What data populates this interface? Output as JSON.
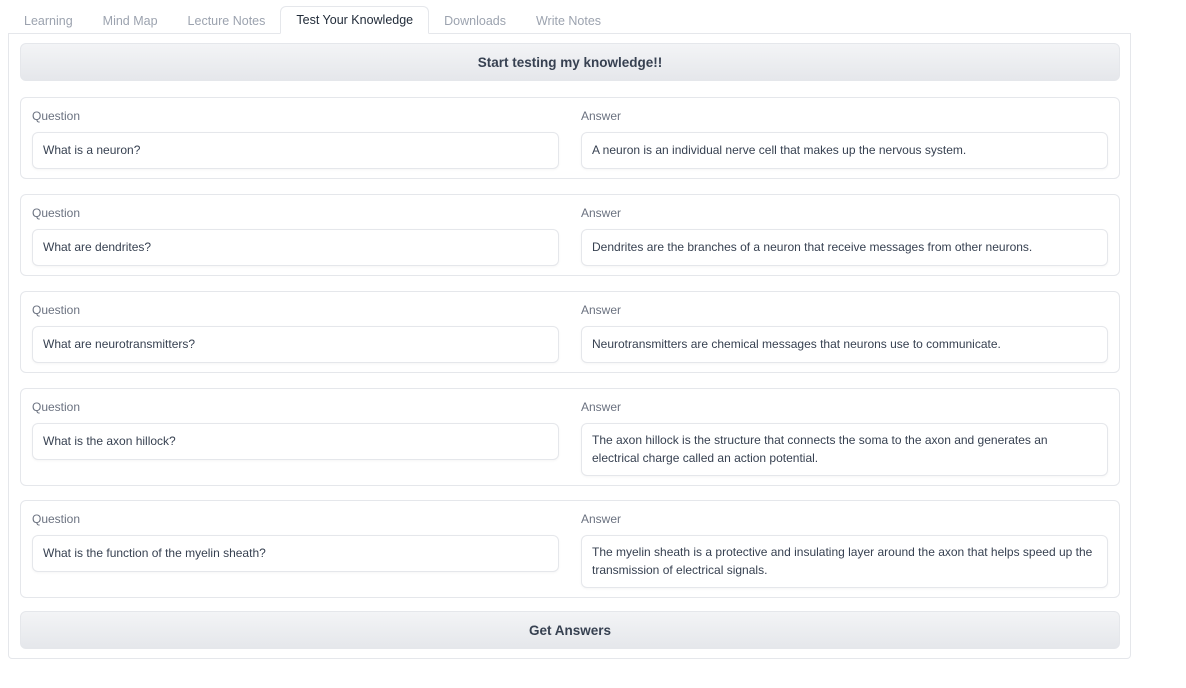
{
  "tabs": [
    {
      "label": "Learning",
      "active": false
    },
    {
      "label": "Mind Map",
      "active": false
    },
    {
      "label": "Lecture Notes",
      "active": false
    },
    {
      "label": "Test Your Knowledge",
      "active": true
    },
    {
      "label": "Downloads",
      "active": false
    },
    {
      "label": "Write Notes",
      "active": false
    }
  ],
  "start_button": "Start testing my knowledge!!",
  "qa": [
    {
      "question_label": "Question",
      "answer_label": "Answer",
      "question": "What is a neuron?",
      "answer": "A neuron is an individual nerve cell that makes up the nervous system."
    },
    {
      "question_label": "Question",
      "answer_label": "Answer",
      "question": "What are dendrites?",
      "answer": "Dendrites are the branches of a neuron that receive messages from other neurons."
    },
    {
      "question_label": "Question",
      "answer_label": "Answer",
      "question": "What are neurotransmitters?",
      "answer": "Neurotransmitters are chemical messages that neurons use to communicate."
    },
    {
      "question_label": "Question",
      "answer_label": "Answer",
      "question": "What is the axon hillock?",
      "answer": "The axon hillock is the structure that connects the soma to the axon and generates an electrical charge called an action potential."
    },
    {
      "question_label": "Question",
      "answer_label": "Answer",
      "question": "What is the function of the myelin sheath?",
      "answer": "The myelin sheath is a protective and insulating layer around the axon that helps speed up the transmission of electrical signals."
    }
  ],
  "get_answers_button": "Get Answers",
  "colors": {
    "border": "#e5e7eb",
    "button_bg": "#f3f4f6",
    "text": "#374151",
    "muted_text": "#9ca3af"
  }
}
